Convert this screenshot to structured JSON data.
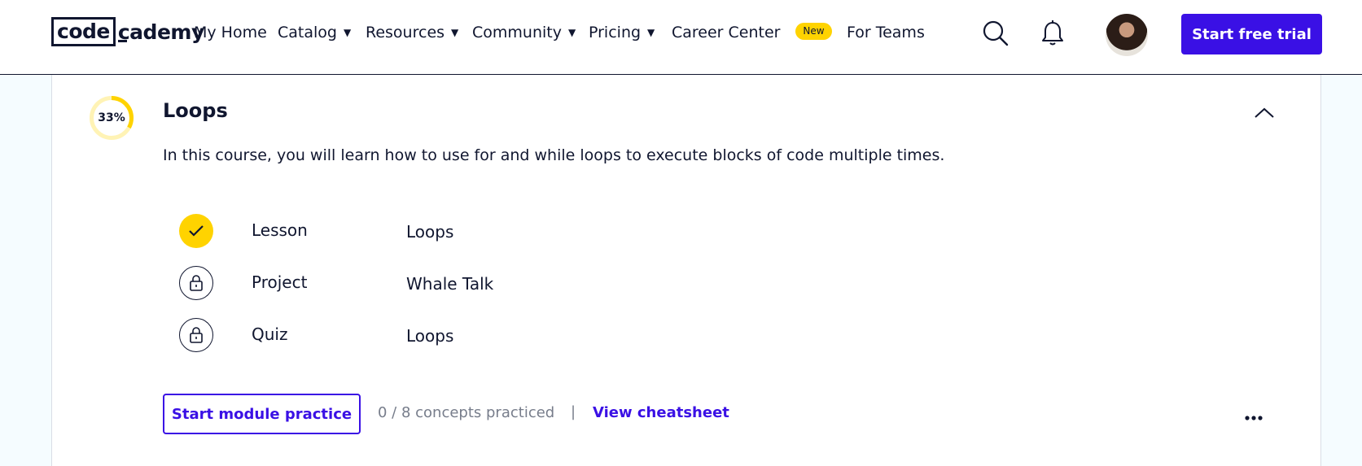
{
  "nav": {
    "logo_left": "code",
    "logo_right": "cademy",
    "items": [
      {
        "label": "My Home"
      },
      {
        "label": "Catalog"
      },
      {
        "label": "Resources"
      },
      {
        "label": "Community"
      },
      {
        "label": "Pricing"
      },
      {
        "label": "Career Center"
      },
      {
        "label": "For Teams"
      }
    ],
    "new_badge": "New",
    "trial_button": "Start free trial",
    "icons": [
      "search-icon",
      "bell-icon",
      "avatar"
    ]
  },
  "module": {
    "progress_percent": 33,
    "progress_label": "33%",
    "title": "Loops",
    "description": "In this course, you will learn how to use for and while loops to execute blocks of code multiple times.",
    "items": [
      {
        "status": "completed",
        "type": "Lesson",
        "name": "Loops"
      },
      {
        "status": "locked",
        "type": "Project",
        "name": "Whale Talk"
      },
      {
        "status": "locked",
        "type": "Quiz",
        "name": "Loops"
      }
    ],
    "practice_button": "Start module practice",
    "concepts_text": "0 / 8 concepts practiced",
    "separator": "|",
    "cheatsheet_link": "View cheatsheet"
  },
  "colors": {
    "brand": "#3a10e5",
    "accent_yellow": "#ffd300",
    "navy": "#10162f",
    "page_bg": "#f5fcff"
  }
}
